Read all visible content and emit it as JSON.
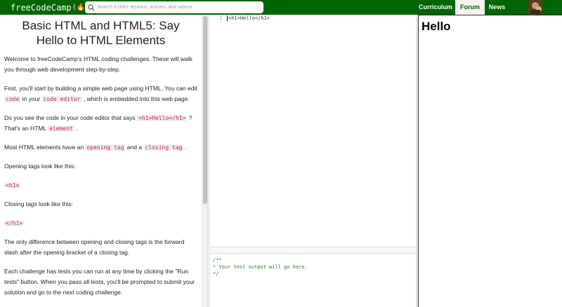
{
  "nav": {
    "logo_text": "freeCodeCamp",
    "logo_mark": "(🔥)",
    "search_placeholder": "Search 8,000+ lessons, articles, and videos",
    "links": [
      "Curriculum",
      "Forum",
      "News"
    ],
    "active_link": "Forum"
  },
  "lesson": {
    "title": "Basic HTML and HTML5: Say Hello to HTML Elements",
    "p1": "Welcome to freeCodeCamp's HTML coding challenges. These will walk you through web development step-by-step.",
    "p2_a": "First, you'll start by building a simple web page using HTML. You can edit ",
    "p2_code1": "code",
    "p2_b": " in your ",
    "p2_code2": "code editor",
    "p2_c": " , which is embedded into this web page.",
    "p3_a": "Do you see the code in your code editor that says ",
    "p3_code": "<h1>Hello</h1>",
    "p3_b": " ? That's an HTML ",
    "p3_code2": "element",
    "p3_c": " .",
    "p4_a": "Most HTML elements have an ",
    "p4_code1": "opening tag",
    "p4_b": " and a ",
    "p4_code2": "closing tag",
    "p4_c": " .",
    "p5": "Opening tags look like this:",
    "p6_code": "<h1>",
    "p7": "Closing tags look like this:",
    "p8_code": "</h1>",
    "p9": "The only difference between opening and closing tags is the forward slash after the opening bracket of a closing tag.",
    "p10": "Each challenge has tests you can run at any time by clicking the \"Run tests\" button. When you pass all tests, you'll be prompted to submit your solution and go to the next coding challenge."
  },
  "editor": {
    "line_number": "1",
    "code": "<h1>Hello</h1>"
  },
  "output": {
    "text": "/**\n* Your test output will go here.\n*/"
  },
  "preview": {
    "heading": "Hello"
  },
  "colors": {
    "nav_bg": "#006400",
    "code_text": "#c7254e",
    "output_comment": "#2a7d2a"
  }
}
